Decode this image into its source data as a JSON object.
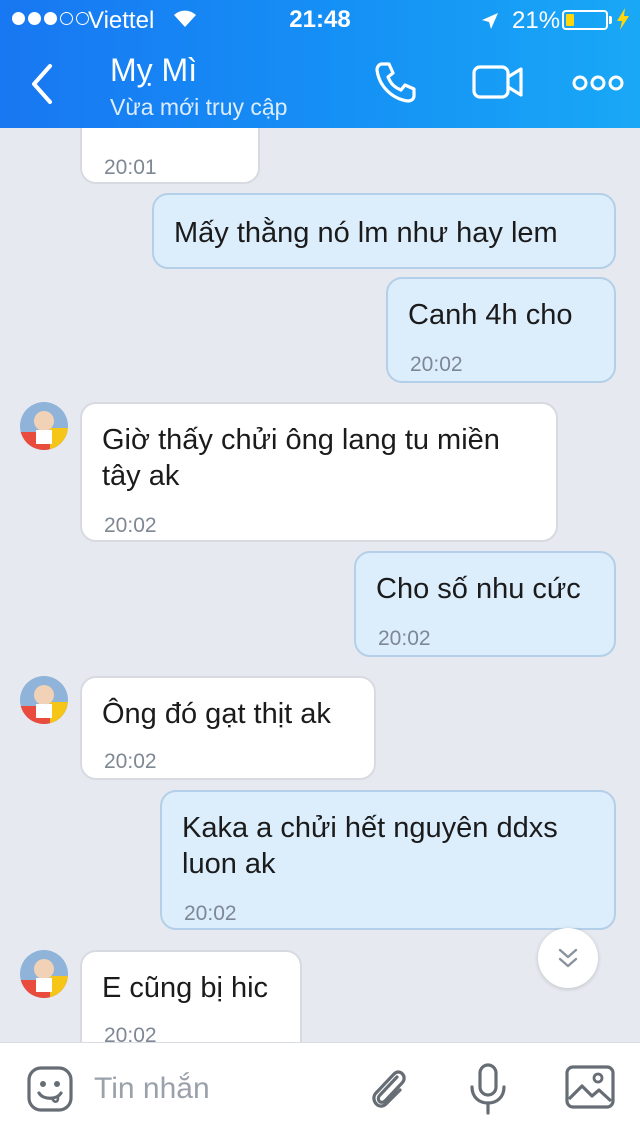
{
  "status_bar": {
    "carrier": "Viettel",
    "time": "21:48",
    "battery_percent": "21%",
    "battery_level": 0.21,
    "signal_bars": 3
  },
  "header": {
    "contact_name": "Mỵ Mì",
    "contact_status": "Vừa mới truy cập",
    "icons": [
      "back-chevron-icon",
      "phone-icon",
      "video-camera-icon",
      "more-dots-icon"
    ]
  },
  "messages": [
    {
      "direction": "incoming",
      "text": "",
      "time": "20:01"
    },
    {
      "direction": "outgoing",
      "text": "Mấy thằng nó lm như hay lem",
      "time": ""
    },
    {
      "direction": "outgoing",
      "text": "Canh 4h cho",
      "time": "20:02"
    },
    {
      "direction": "incoming",
      "text": "Giờ thấy chửi ông lang tu miền tây ak",
      "time": "20:02"
    },
    {
      "direction": "outgoing",
      "text": "Cho số nhu cức",
      "time": "20:02"
    },
    {
      "direction": "incoming",
      "text": "Ông đó gạt thịt ak",
      "time": "20:02"
    },
    {
      "direction": "outgoing",
      "text": "Kaka a chửi hết nguyên ddxs luon ak",
      "time": "20:02"
    },
    {
      "direction": "incoming",
      "text": "E cũng bị hic",
      "time": "20:02"
    }
  ],
  "composer": {
    "placeholder": "Tin nhắn",
    "icons": [
      "emoji-icon",
      "paperclip-icon",
      "microphone-icon",
      "image-icon"
    ]
  },
  "colors": {
    "header_gradient_start": "#1877f2",
    "header_gradient_end": "#19a8f6",
    "outgoing_bubble": "#dcedfc",
    "incoming_bubble": "#ffffff",
    "chat_background": "#e6eaf0",
    "battery_low": "#ffd60a"
  }
}
